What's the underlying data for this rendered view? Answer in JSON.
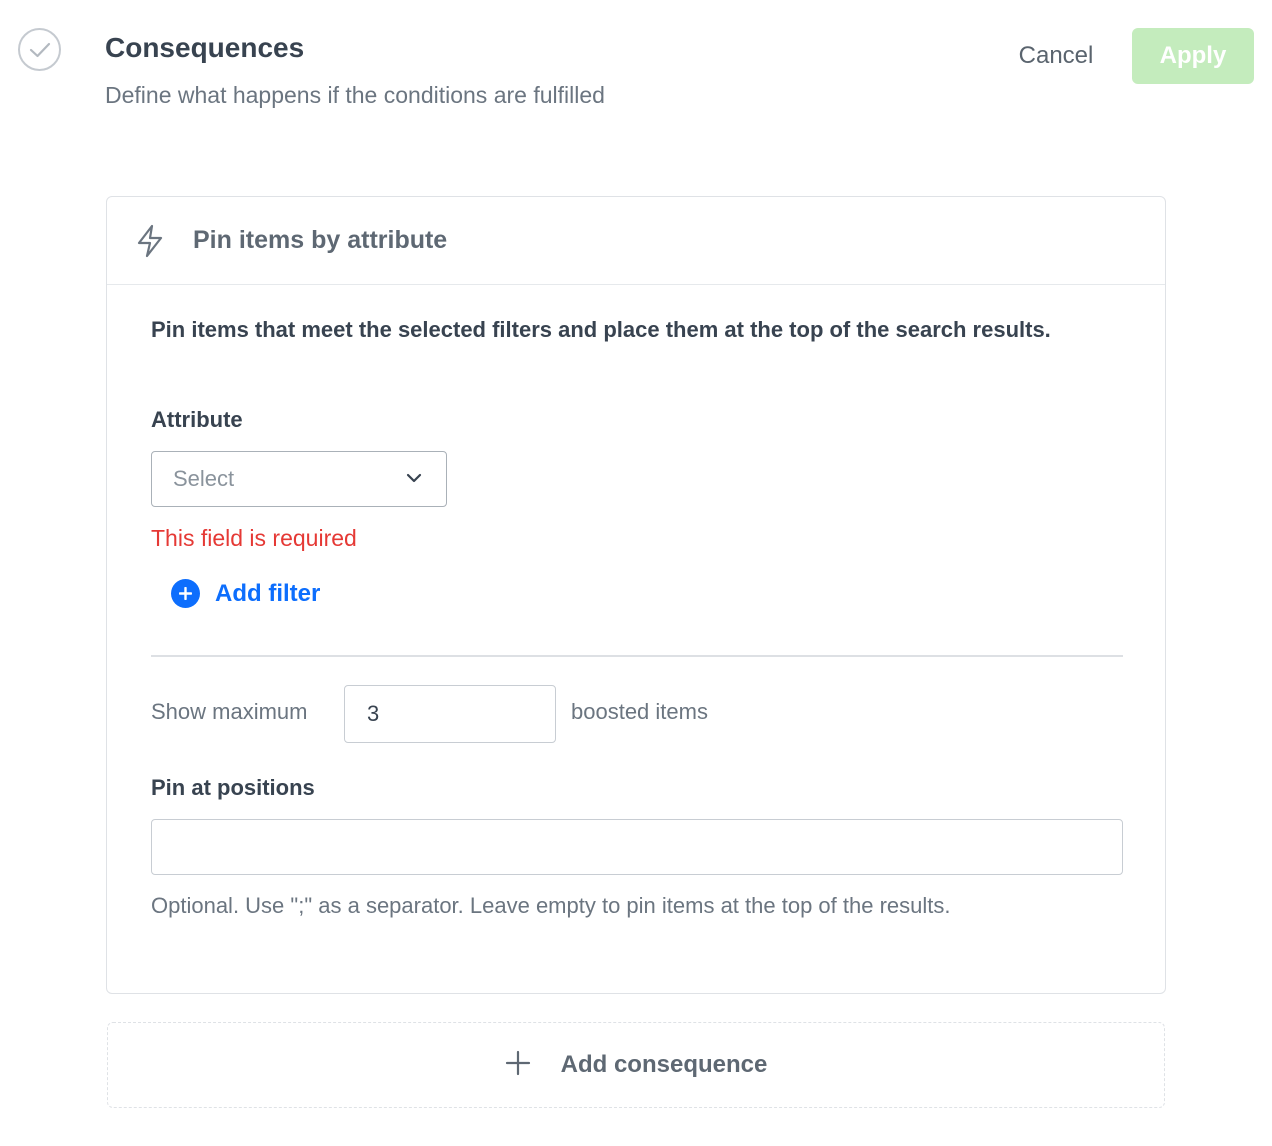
{
  "header": {
    "title": "Consequences",
    "subtitle": "Define what happens if the conditions are fulfilled",
    "cancel_label": "Cancel",
    "apply_label": "Apply",
    "step_icon": "check-circle-icon"
  },
  "consequence": {
    "icon": "lightning-bolt-icon",
    "title": "Pin items by attribute",
    "description": "Pin items that meet the selected filters and place them at the top of the search results.",
    "attribute": {
      "label": "Attribute",
      "placeholder": "Select",
      "error": "This field is required"
    },
    "add_filter_label": "Add filter",
    "show_maximum": {
      "prefix": "Show maximum",
      "value": "3",
      "suffix": "boosted items"
    },
    "pin_positions": {
      "label": "Pin at positions",
      "value": "",
      "helper": "Optional. Use \";\" as a separator. Leave empty to pin items at the top of the results."
    }
  },
  "add_consequence_label": "Add consequence",
  "colors": {
    "primary_blue": "#0d6efd",
    "apply_disabled_green": "#c4ecbd",
    "error_red": "#e53935"
  }
}
